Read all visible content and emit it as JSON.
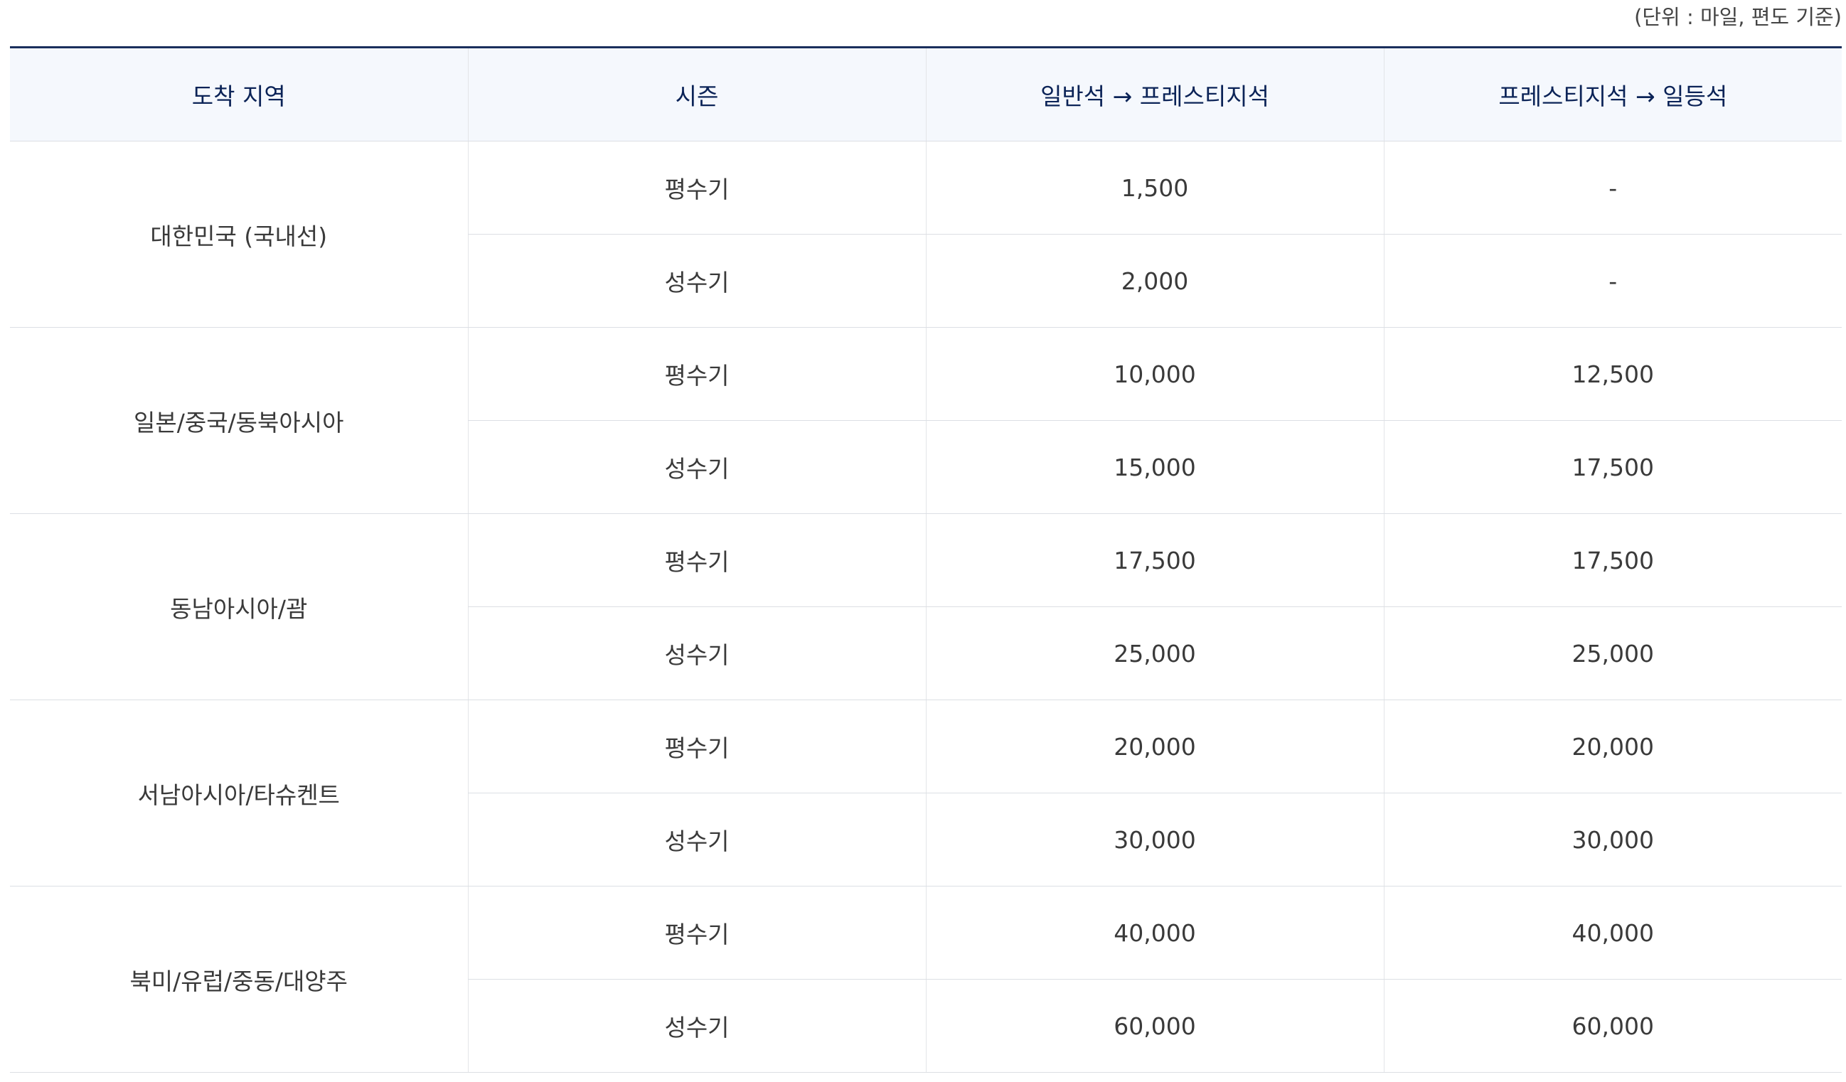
{
  "unit_note": "(단위 : 마일, 편도 기준)",
  "table": {
    "headers": [
      "도착 지역",
      "시즌",
      "일반석 → 프레스티지석",
      "프레스티지석 → 일등석"
    ],
    "regions": [
      {
        "name": "대한민국 (국내선)",
        "rows": [
          {
            "season": "평수기",
            "economy_to_prestige": "1,500",
            "prestige_to_first": "-"
          },
          {
            "season": "성수기",
            "economy_to_prestige": "2,000",
            "prestige_to_first": "-"
          }
        ]
      },
      {
        "name": "일본/중국/동북아시아",
        "rows": [
          {
            "season": "평수기",
            "economy_to_prestige": "10,000",
            "prestige_to_first": "12,500"
          },
          {
            "season": "성수기",
            "economy_to_prestige": "15,000",
            "prestige_to_first": "17,500"
          }
        ]
      },
      {
        "name": "동남아시아/괌",
        "rows": [
          {
            "season": "평수기",
            "economy_to_prestige": "17,500",
            "prestige_to_first": "17,500"
          },
          {
            "season": "성수기",
            "economy_to_prestige": "25,000",
            "prestige_to_first": "25,000"
          }
        ]
      },
      {
        "name": "서남아시아/타슈켄트",
        "rows": [
          {
            "season": "평수기",
            "economy_to_prestige": "20,000",
            "prestige_to_first": "20,000"
          },
          {
            "season": "성수기",
            "economy_to_prestige": "30,000",
            "prestige_to_first": "30,000"
          }
        ]
      },
      {
        "name": "북미/유럽/중동/대양주",
        "rows": [
          {
            "season": "평수기",
            "economy_to_prestige": "40,000",
            "prestige_to_first": "40,000"
          },
          {
            "season": "성수기",
            "economy_to_prestige": "60,000",
            "prestige_to_first": "60,000"
          }
        ]
      }
    ]
  }
}
